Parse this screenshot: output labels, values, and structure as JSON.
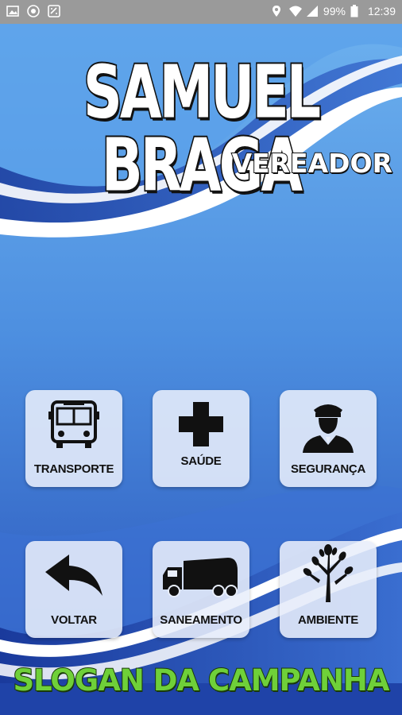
{
  "status_bar": {
    "left_icons": [
      "image-icon",
      "chrome-icon",
      "data-saver-icon"
    ],
    "right_icons": [
      "location-icon",
      "wifi-icon",
      "signal-icon",
      "battery-icon"
    ],
    "battery": "99%",
    "time": "12:39"
  },
  "header": {
    "title": "SAMUEL BRAGA",
    "subtitle": "VEREADOR"
  },
  "tiles": [
    {
      "label": "TRANSPORTE",
      "icon": "bus-icon"
    },
    {
      "label": "SAÚDE",
      "icon": "medical-cross-icon"
    },
    {
      "label": "SEGURANÇA",
      "icon": "security-guard-icon"
    },
    {
      "label": "VOLTAR",
      "icon": "back-arrow-icon"
    },
    {
      "label": "SANEAMENTO",
      "icon": "garbage-truck-icon"
    },
    {
      "label": "AMBIENTE",
      "icon": "tree-icon"
    }
  ],
  "footer": {
    "slogan": "SLOGAN DA CAMPANHA"
  },
  "colors": {
    "background": "#2d62c8",
    "tile": "#e8eefa",
    "slogan": "#6fd039"
  }
}
